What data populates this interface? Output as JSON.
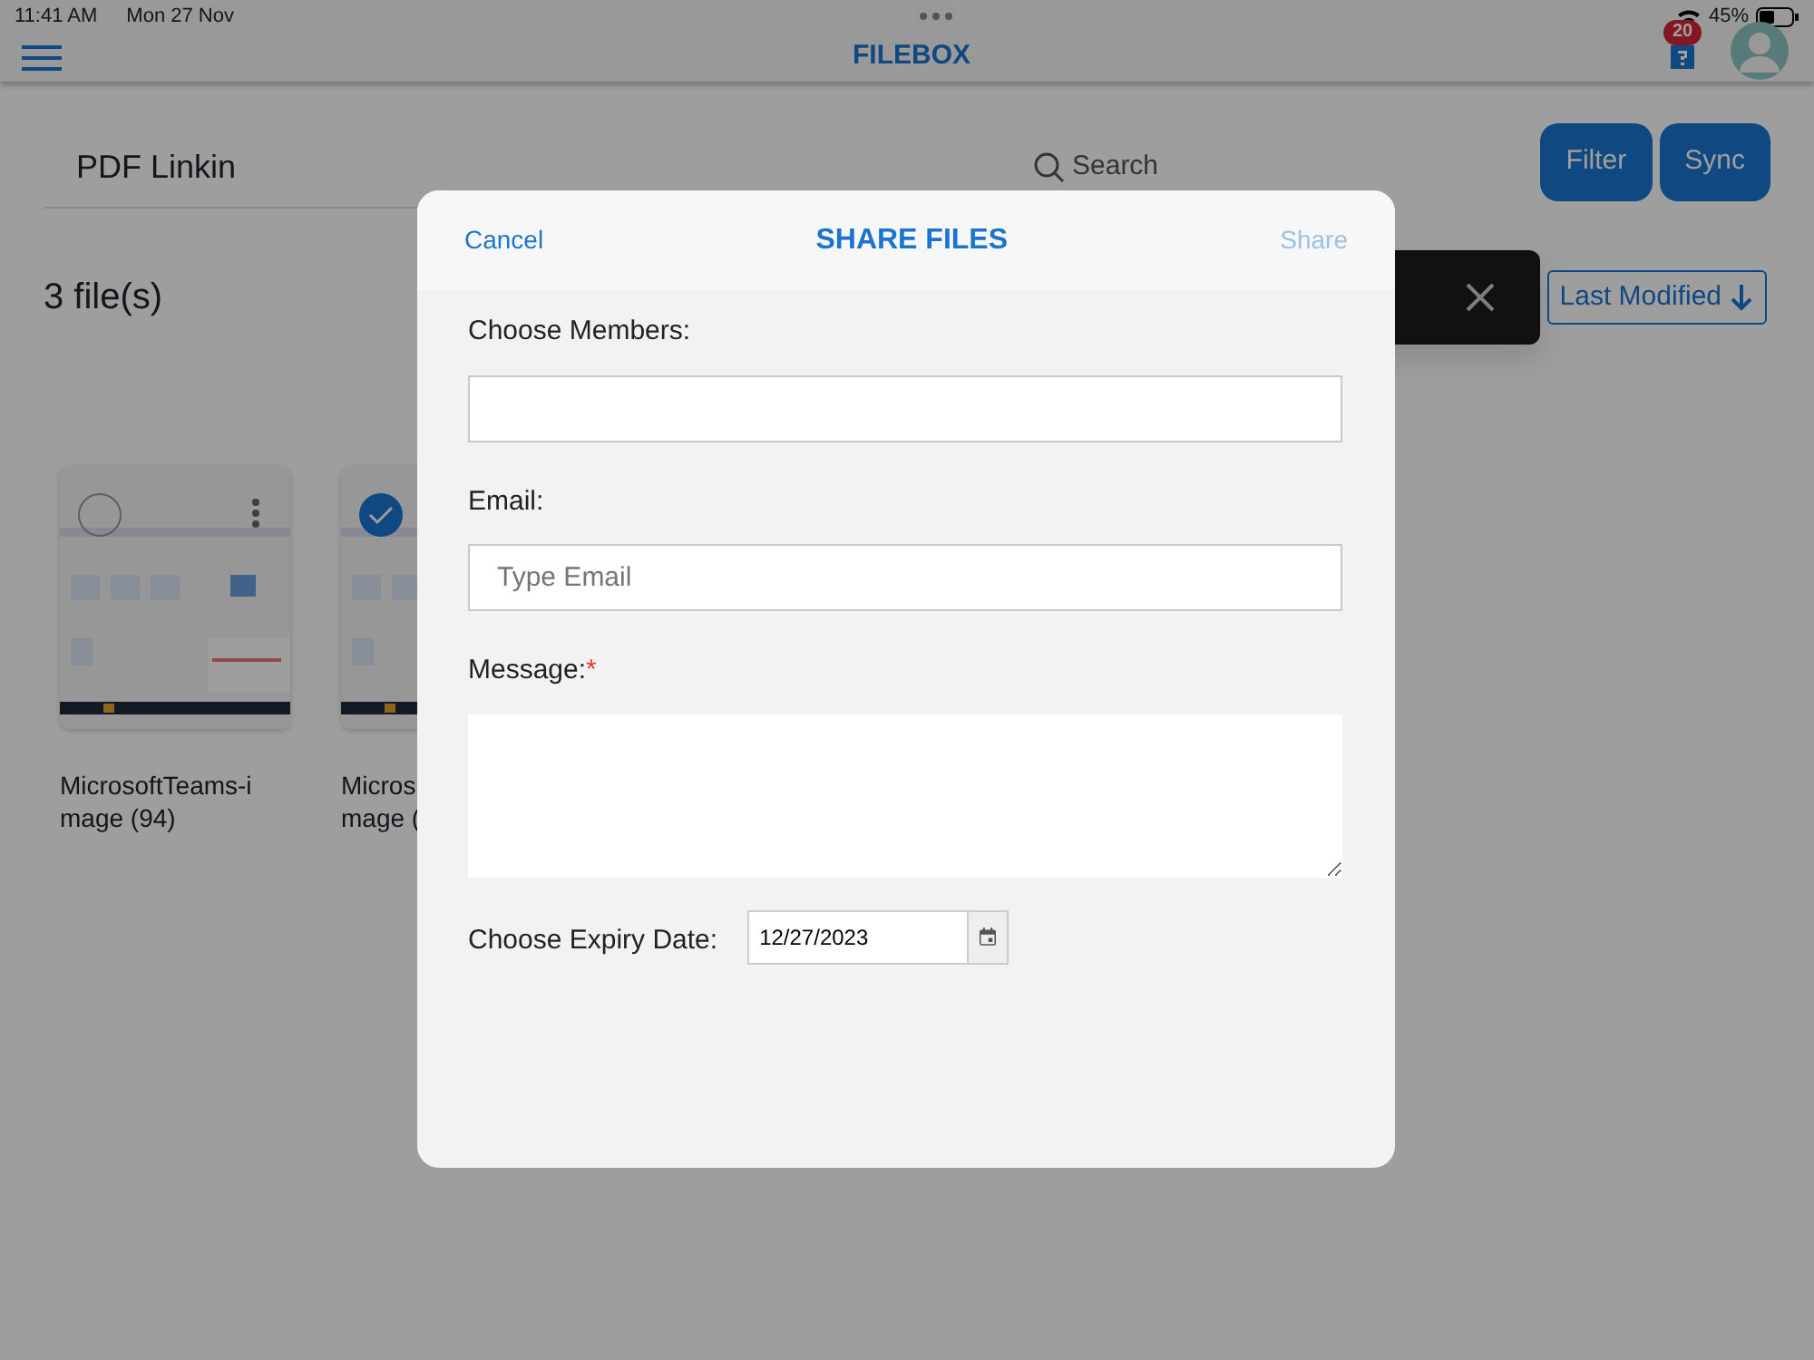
{
  "status_bar": {
    "time": "11:41 AM",
    "date": "Mon 27 Nov",
    "battery": "45%"
  },
  "header": {
    "title": "FILEBOX",
    "notification_count": "20"
  },
  "toolbar": {
    "folder": "PDF Linkin",
    "search_placeholder": "Search",
    "buttons": [
      "Filter",
      "Sync"
    ]
  },
  "file_count": "3 file(s)",
  "sort": {
    "label": "Last Modified",
    "descending": true
  },
  "files": [
    {
      "name_lines": [
        "MicrosoftTeams-i",
        "mage (94)"
      ],
      "selected": false,
      "more_menu": true,
      "thumbnail": {
        "kind": "picture"
      }
    },
    {
      "name_lines": [
        "Micros",
        "mage ("
      ],
      "selected": true,
      "thumbnail": {
        "kind": "picture"
      }
    }
  ],
  "dialog": {
    "title": "SHARE FILES",
    "cancel": "Cancel",
    "share": "Share",
    "share_disabled": true,
    "fields": [
      {
        "kind": "text",
        "label": "Choose Members:"
      },
      {
        "kind": "text",
        "label": "Email:",
        "placeholder": "Type Email"
      },
      {
        "kind": "textarea",
        "label": "Message:",
        "required_mark": "*"
      }
    ],
    "expiry": {
      "label": "Choose Expiry Date:",
      "value": "12/27/2023"
    }
  }
}
